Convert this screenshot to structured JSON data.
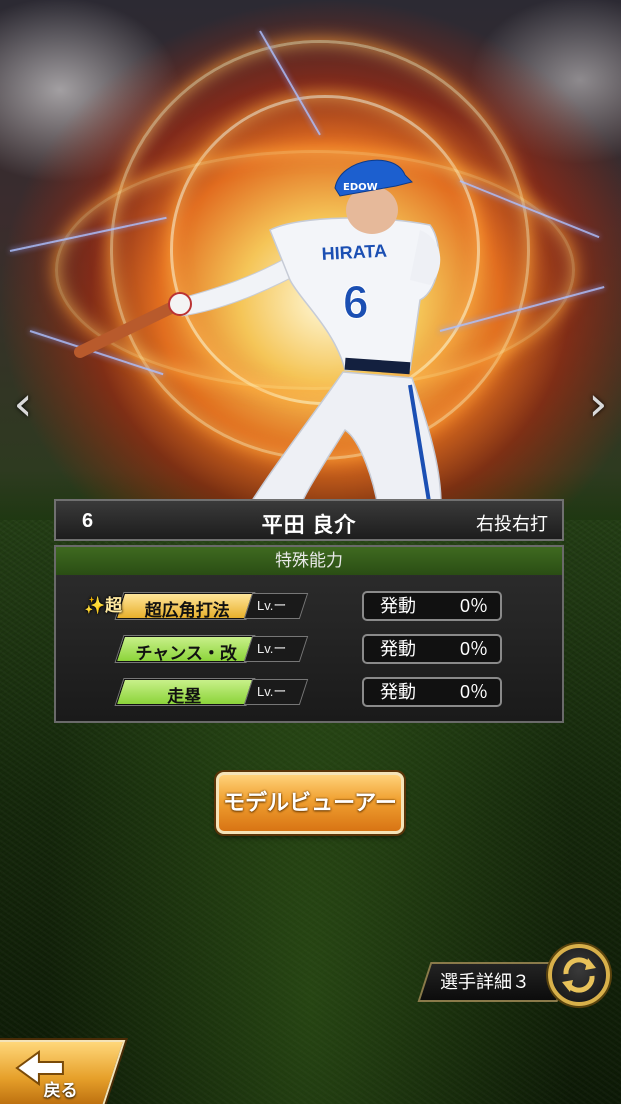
{
  "hero": {
    "jersey_name": "HIRATA",
    "jersey_number": "6",
    "cap_logo": "EDOW"
  },
  "nav": {
    "prev_glyph": "‹",
    "next_glyph": "›"
  },
  "player": {
    "number": "6",
    "name": "平田 良介",
    "throw_bat": "右投右打"
  },
  "abilities": {
    "header": "特殊能力",
    "items": [
      {
        "prefix": "✨超",
        "name": "超広角打法",
        "level": "Lv.ー",
        "status_label": "発動",
        "rate": "0％",
        "color": "#f2c44a"
      },
      {
        "prefix": "",
        "name": "チャンス・改",
        "level": "Lv.ー",
        "status_label": "発動",
        "rate": "0％",
        "color": "#9adf4a"
      },
      {
        "prefix": "",
        "name": "走塁",
        "level": "Lv.ー",
        "status_label": "発動",
        "rate": "0％",
        "color": "#9adf4a"
      }
    ]
  },
  "buttons": {
    "model_viewer": "モデルビューアー",
    "player_detail": "選手詳細３",
    "back": "戻る"
  },
  "colors": {
    "accent_orange": "#f0a030",
    "gold_border": "#d8b04a",
    "green_header": "#3f6a20"
  }
}
